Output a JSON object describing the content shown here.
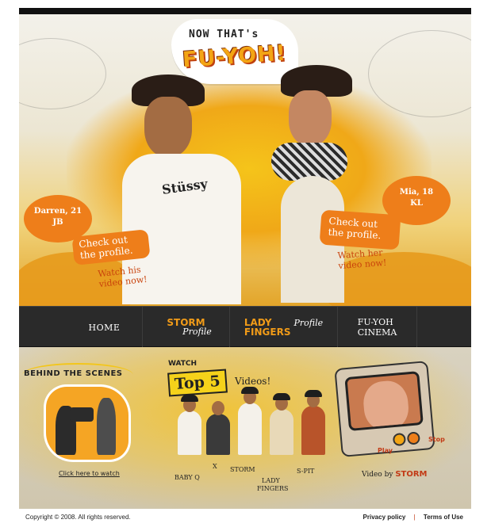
{
  "hero": {
    "logo_top": "NOW THAT's",
    "logo_main": "FU-YOH!",
    "left": {
      "name": "Darren, 21",
      "place": "JB",
      "check_line1": "Check out",
      "check_line2": "the profile.",
      "watch_line1": "Watch his",
      "watch_line2": "video now!"
    },
    "right": {
      "name": "Mia, 18",
      "place": "KL",
      "check_line1": "Check out",
      "check_line2": "the profile.",
      "watch_line1": "Watch her",
      "watch_line2": "video now!"
    },
    "shirt_art": "Stüssy"
  },
  "nav": {
    "home": "HOME",
    "storm_main": "STORM",
    "storm_sub": "Profile",
    "lady_main_1": "LADY",
    "lady_main_2": "FINGERS",
    "lady_sub": "Profile",
    "cinema_1": "FU-YOH",
    "cinema_2": "CINEMA"
  },
  "lower": {
    "behind_title": "BEHIND THE SCENES",
    "behind_link": "Click here to watch",
    "watch": "WATCH",
    "top5": "Top 5",
    "videos": "Videos!",
    "members": [
      "BABY Q",
      "X",
      "STORM",
      "LADY",
      "FINGERS",
      "S-PIT"
    ],
    "tv_play": "Play",
    "tv_stop": "Stop",
    "video_by": "Video by",
    "video_by_name": "STORM"
  },
  "footer": {
    "copyright": "Copyright © 2008. All rights reserved.",
    "privacy": "Privacy policy",
    "sep": "|",
    "terms": "Terms of Use"
  },
  "colors": {
    "accent_orange": "#ee7e1a",
    "brand_yellow": "#f3a514",
    "nav_bg": "#2a2a2a",
    "storm_red": "#c23a16"
  }
}
